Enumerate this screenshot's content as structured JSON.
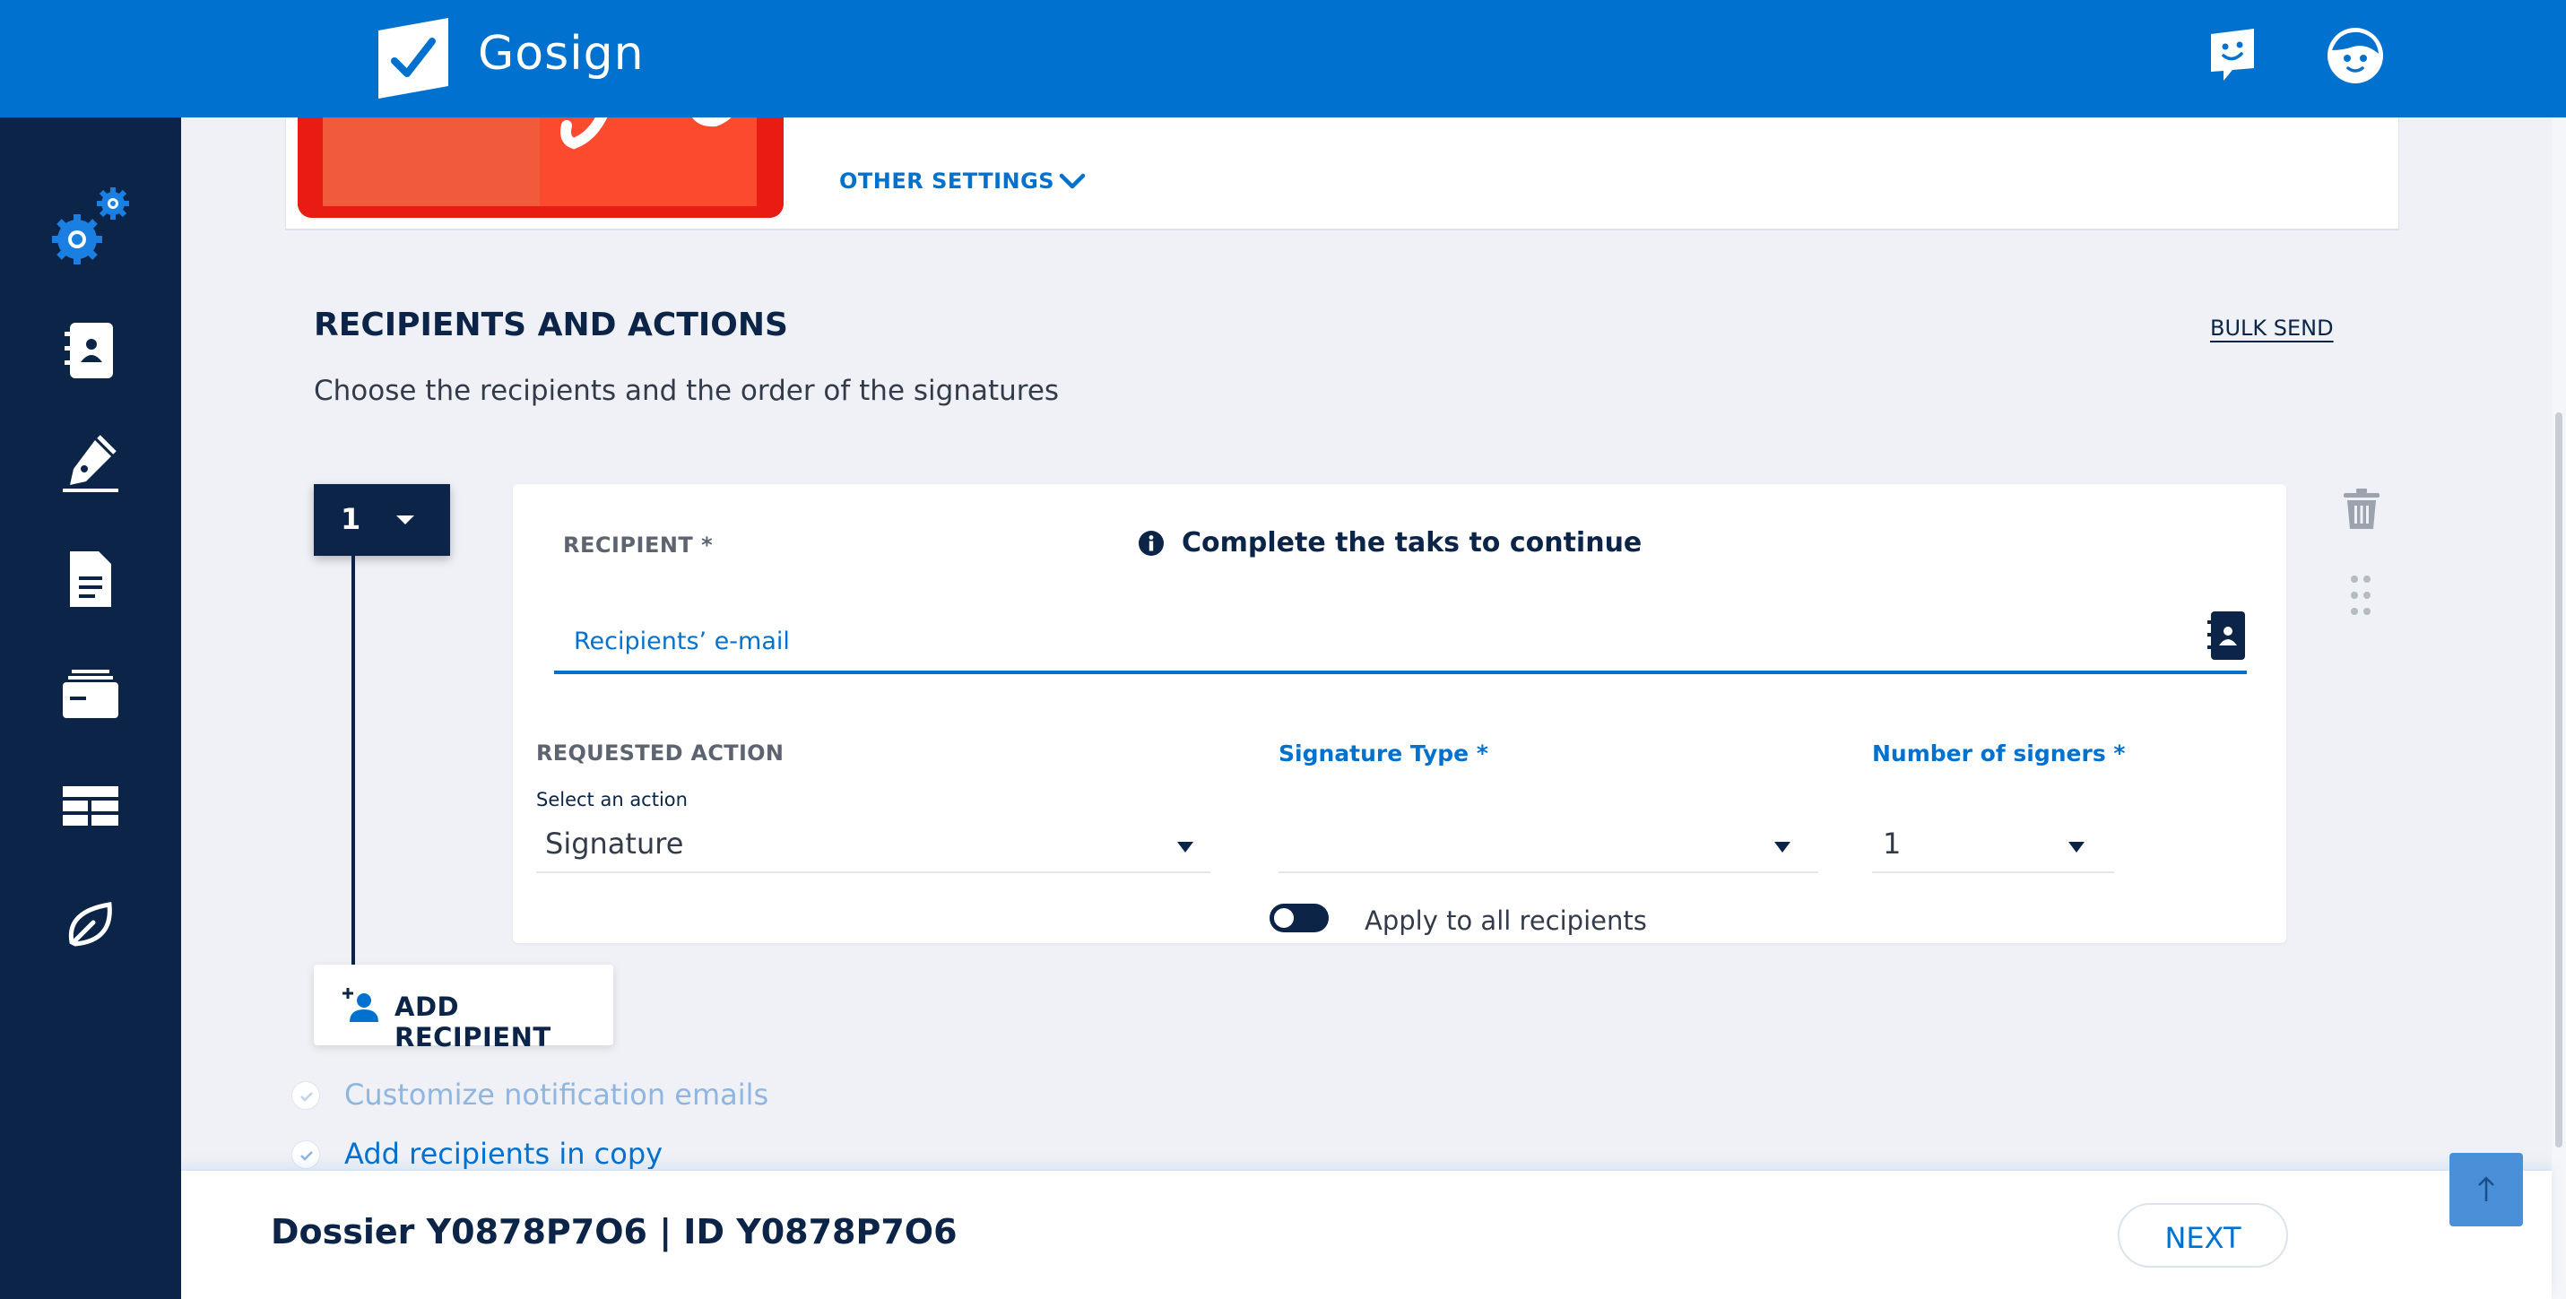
{
  "header": {
    "app_title": "Gosign",
    "brand_color": "#0071cf",
    "icons": [
      "logo-check-icon",
      "help-chat-icon",
      "user-avatar-icon"
    ]
  },
  "sidebar": {
    "background": "#0b2447",
    "items": [
      {
        "name": "settings",
        "icon": "gears-icon",
        "active": true
      },
      {
        "name": "address-book",
        "icon": "address-book-icon"
      },
      {
        "name": "signature",
        "icon": "pen-signature-icon"
      },
      {
        "name": "documents",
        "icon": "document-icon"
      },
      {
        "name": "archive",
        "icon": "archive-icon"
      },
      {
        "name": "table",
        "icon": "table-icon"
      },
      {
        "name": "eco",
        "icon": "leaf-icon"
      }
    ]
  },
  "top_card": {
    "other_settings_label": "OTHER SETTINGS"
  },
  "section": {
    "title": "RECIPIENTS AND ACTIONS",
    "subtitle": "Choose the recipients and the order of the signatures",
    "bulk_send_label": "BULK SEND"
  },
  "recipient": {
    "order_number": "1",
    "recipient_label": "RECIPIENT *",
    "info_text": "Complete the taks to continue",
    "email_placeholder": "Recipients’ e-mail",
    "requested_action_label": "REQUESTED ACTION",
    "select_action_label": "Select an action",
    "action_value": "Signature",
    "signature_type_label": "Signature Type *",
    "signature_type_value": "",
    "number_signers_label": "Number of signers *",
    "number_signers_value": "1",
    "apply_all_label": "Apply to all recipients",
    "apply_all_on": false
  },
  "add_recipient_label": "ADD RECIPIENT",
  "options": [
    {
      "label": "Customize notification emails",
      "enabled": false
    },
    {
      "label": "Add recipients in copy",
      "enabled": true
    }
  ],
  "footer": {
    "dossier_text": "Dossier Y0878P7O6 | ID Y0878P7O6",
    "next_label": "NEXT"
  }
}
